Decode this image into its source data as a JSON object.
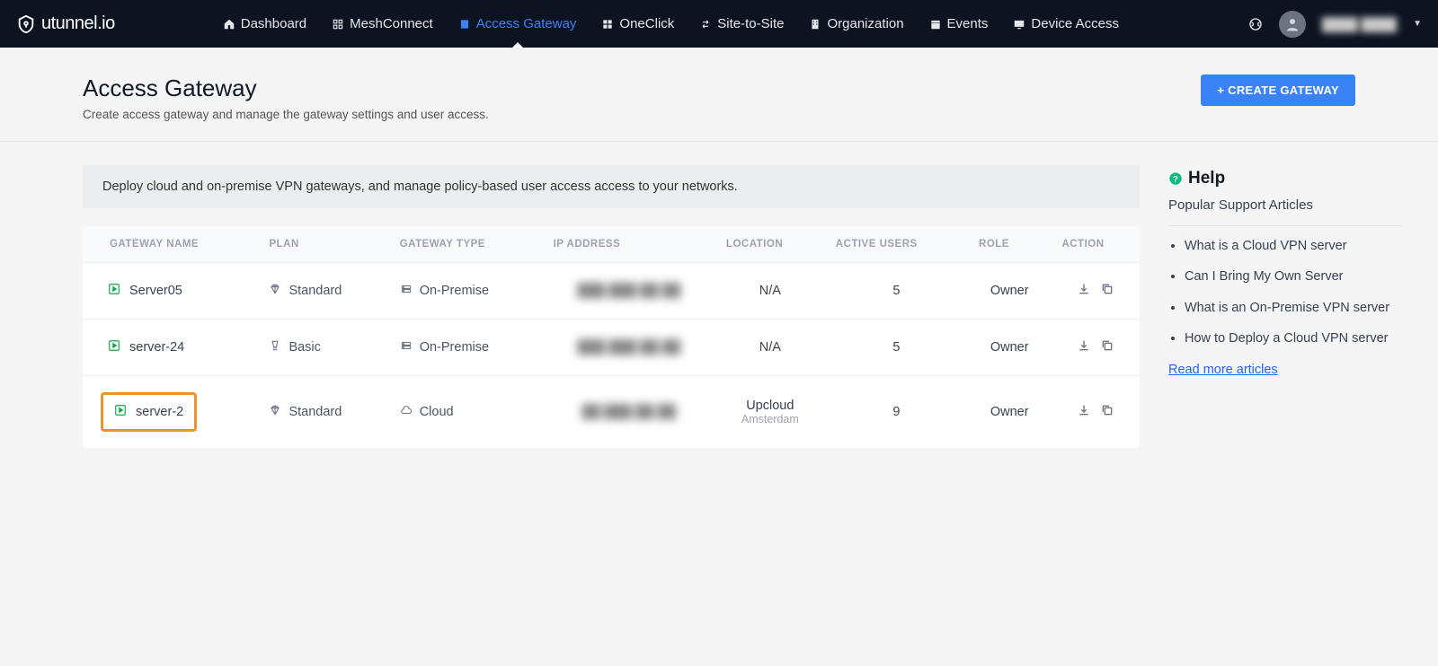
{
  "brand": "utunnel.io",
  "nav": {
    "items": [
      {
        "label": "Dashboard",
        "icon": "home"
      },
      {
        "label": "MeshConnect",
        "icon": "mesh"
      },
      {
        "label": "Access Gateway",
        "icon": "gateway",
        "active": true
      },
      {
        "label": "OneClick",
        "icon": "oneclick"
      },
      {
        "label": "Site-to-Site",
        "icon": "s2s"
      },
      {
        "label": "Organization",
        "icon": "org"
      },
      {
        "label": "Events",
        "icon": "events"
      },
      {
        "label": "Device Access",
        "icon": "device"
      }
    ],
    "user": "████ ████"
  },
  "header": {
    "title": "Access Gateway",
    "subtitle": "Create access gateway and manage the gateway settings and user access.",
    "create_button": "+ CREATE GATEWAY"
  },
  "banner": "Deploy cloud and on-premise VPN gateways, and manage policy-based user access access to your networks.",
  "table": {
    "columns": [
      "GATEWAY NAME",
      "PLAN",
      "GATEWAY TYPE",
      "IP ADDRESS",
      "LOCATION",
      "ACTIVE USERS",
      "ROLE",
      "ACTION"
    ],
    "rows": [
      {
        "name": "Server05",
        "plan": "Standard",
        "plan_icon": "diamond",
        "type": "On-Premise",
        "type_icon": "server",
        "ip": "███.███.██.██",
        "location": "N/A",
        "location_sub": "",
        "active_users": "5",
        "role": "Owner",
        "highlighted": false
      },
      {
        "name": "server-24",
        "plan": "Basic",
        "plan_icon": "trophy",
        "type": "On-Premise",
        "type_icon": "server",
        "ip": "███.███.██.██",
        "location": "N/A",
        "location_sub": "",
        "active_users": "5",
        "role": "Owner",
        "highlighted": false
      },
      {
        "name": "server-2",
        "plan": "Standard",
        "plan_icon": "diamond",
        "type": "Cloud",
        "type_icon": "cloud",
        "ip": "██.███.██.██",
        "location": "Upcloud",
        "location_sub": "Amsterdam",
        "active_users": "9",
        "role": "Owner",
        "highlighted": true
      }
    ]
  },
  "help": {
    "title": "Help",
    "subtitle": "Popular Support Articles",
    "articles": [
      "What is a Cloud VPN server",
      "Can I Bring My Own Server",
      "What is an On-Premise VPN server",
      "How to Deploy a Cloud VPN server"
    ],
    "read_more": "Read more articles"
  }
}
